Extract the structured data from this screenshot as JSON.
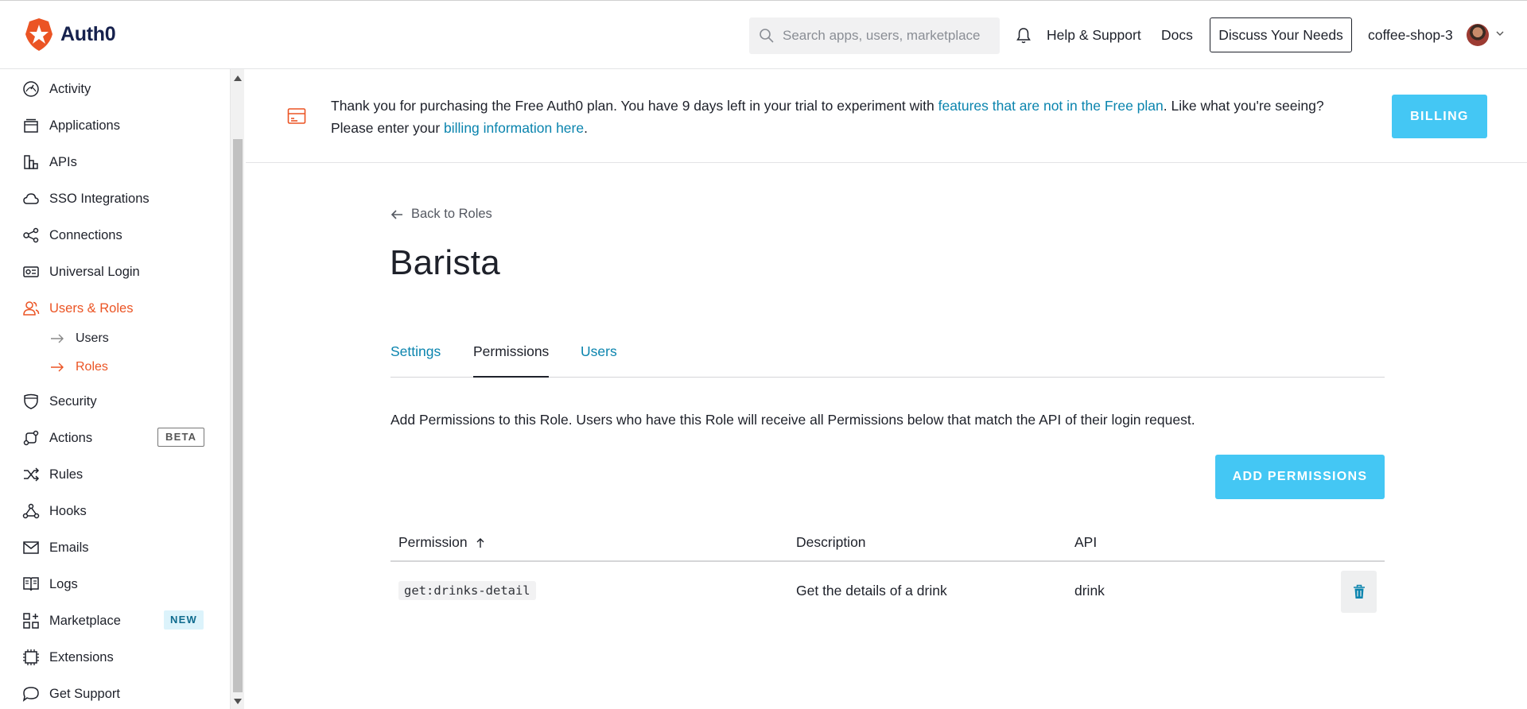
{
  "header": {
    "brand": "Auth0",
    "search_placeholder": "Search apps, users, marketplace",
    "help_label": "Help & Support",
    "docs_label": "Docs",
    "discuss_label": "Discuss Your Needs",
    "tenant_name": "coffee-shop-3"
  },
  "sidebar": {
    "items": [
      {
        "label": "Activity",
        "icon": "activity-icon"
      },
      {
        "label": "Applications",
        "icon": "applications-icon"
      },
      {
        "label": "APIs",
        "icon": "apis-icon"
      },
      {
        "label": "SSO Integrations",
        "icon": "cloud-icon"
      },
      {
        "label": "Connections",
        "icon": "connections-icon"
      },
      {
        "label": "Universal Login",
        "icon": "login-icon"
      },
      {
        "label": "Users & Roles",
        "icon": "users-icon"
      },
      {
        "label": "Security",
        "icon": "shield-icon"
      },
      {
        "label": "Actions",
        "icon": "actions-icon",
        "badge": "BETA"
      },
      {
        "label": "Rules",
        "icon": "shuffle-icon"
      },
      {
        "label": "Hooks",
        "icon": "hooks-icon"
      },
      {
        "label": "Emails",
        "icon": "envelope-icon"
      },
      {
        "label": "Logs",
        "icon": "book-icon"
      },
      {
        "label": "Marketplace",
        "icon": "grid-plus-icon",
        "badge": "NEW"
      },
      {
        "label": "Extensions",
        "icon": "chip-icon"
      },
      {
        "label": "Get Support",
        "icon": "chat-bubble-icon"
      }
    ],
    "sub_items": [
      {
        "label": "Users"
      },
      {
        "label": "Roles"
      }
    ]
  },
  "banner": {
    "text_1": "Thank you for purchasing the Free Auth0 plan. You have 9 days left in your trial to experiment with ",
    "link_1": "features that are not in the Free plan",
    "text_2": ". Like what you're seeing?",
    "text_3": "Please enter your ",
    "link_2": "billing information here",
    "text_4": ".",
    "billing_label": "BILLING"
  },
  "main": {
    "back_label": "Back to Roles",
    "title": "Barista",
    "tabs": [
      {
        "label": "Settings"
      },
      {
        "label": "Permissions"
      },
      {
        "label": "Users"
      }
    ],
    "description": "Add Permissions to this Role. Users who have this Role will receive all Permissions below that match the API of their login request.",
    "add_label": "ADD PERMISSIONS",
    "table": {
      "headers": [
        "Permission",
        "Description",
        "API"
      ],
      "rows": [
        {
          "permission": "get:drinks-detail",
          "description": "Get the details of a drink",
          "api": "drink"
        }
      ]
    }
  },
  "colors": {
    "accent": "#eb5424",
    "link": "#0a84ae",
    "button": "#44c7f4"
  }
}
